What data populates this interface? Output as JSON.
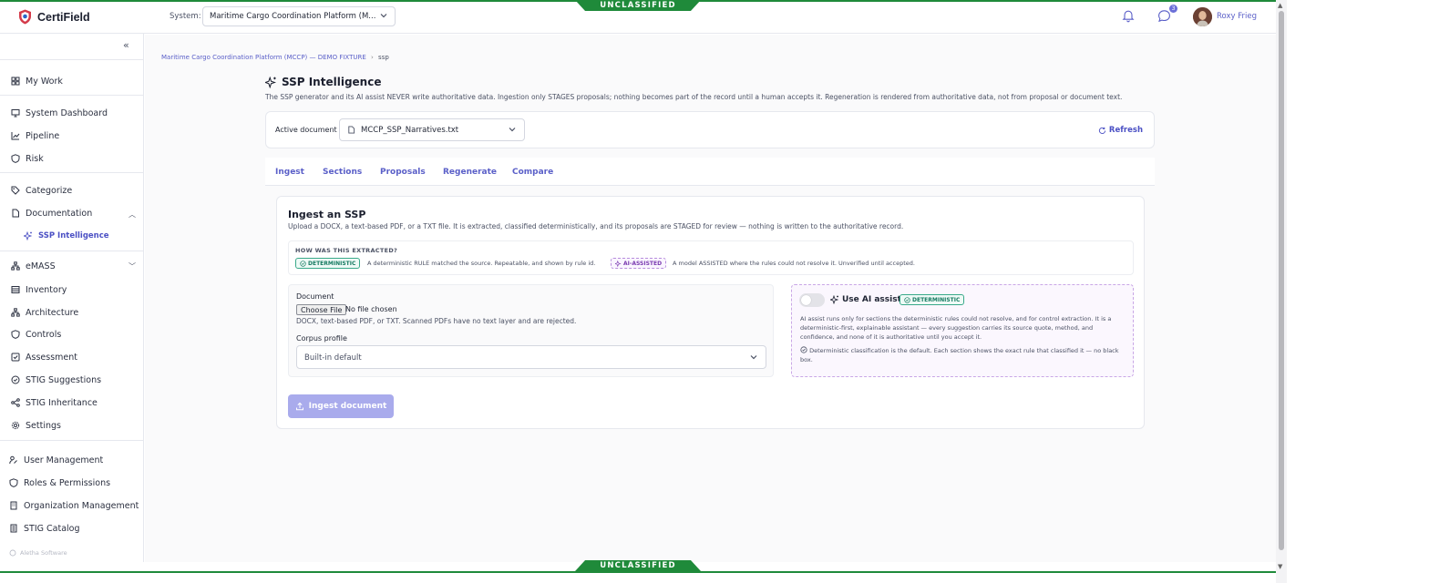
{
  "classification": {
    "banner": "UNCLASSIFIED"
  },
  "app": {
    "name": "CertiField"
  },
  "header": {
    "system_label": "System:",
    "system_value": "Maritime Cargo Coordination Platform (M...",
    "notification_count": "3",
    "user_name": "Roxy Frieg"
  },
  "sidebar": {
    "collapse_icon": "«",
    "items": [
      {
        "label": "My Work",
        "icon": "grid-icon"
      },
      {
        "label": "System Dashboard",
        "icon": "monitor-icon"
      },
      {
        "label": "Pipeline",
        "icon": "trend-icon"
      },
      {
        "label": "Risk",
        "icon": "shield-icon"
      },
      {
        "label": "Categorize",
        "icon": "tag-icon"
      },
      {
        "label": "Documentation",
        "icon": "file-icon"
      },
      {
        "label": "SSP Intelligence",
        "icon": "sparkle-icon"
      },
      {
        "label": "eMASS",
        "icon": "network-icon"
      },
      {
        "label": "Inventory",
        "icon": "list-icon"
      },
      {
        "label": "Architecture",
        "icon": "network-icon"
      },
      {
        "label": "Controls",
        "icon": "shield-icon"
      },
      {
        "label": "Assessment",
        "icon": "check-square-icon"
      },
      {
        "label": "STIG Suggestions",
        "icon": "check-circle-icon"
      },
      {
        "label": "STIG Inheritance",
        "icon": "share-icon"
      },
      {
        "label": "Settings",
        "icon": "gear-icon"
      },
      {
        "label": "User Management",
        "icon": "user-pen-icon"
      },
      {
        "label": "Roles & Permissions",
        "icon": "shield-icon"
      },
      {
        "label": "Organization Management",
        "icon": "building-icon"
      },
      {
        "label": "STIG Catalog",
        "icon": "book-icon"
      }
    ],
    "footer": "Aletha Software"
  },
  "breadcrumb": {
    "root": "Maritime Cargo Coordination Platform (MCCP) — DEMO FIXTURE",
    "sep": "›",
    "current": "ssp"
  },
  "page": {
    "title": "SSP Intelligence",
    "description": "The SSP generator and its AI assist NEVER write authoritative data. Ingestion only STAGES proposals; nothing becomes part of the record until a human accepts it. Regeneration is rendered from authoritative data, not from proposal or document text."
  },
  "document_bar": {
    "label": "Active document",
    "selected": "MCCP_SSP_Narratives.txt",
    "refresh": "Refresh"
  },
  "tabs": [
    "Ingest",
    "Sections",
    "Proposals",
    "Regenerate",
    "Compare"
  ],
  "ingest": {
    "title": "Ingest an SSP",
    "description": "Upload a DOCX, a text-based PDF, or a TXT file. It is extracted, classified deterministically, and its proposals are STAGED for review — nothing is written to the authoritative record.",
    "how_title": "HOW WAS THIS EXTRACTED?",
    "det_pill": "DETERMINISTIC",
    "det_text": "A deterministic RULE matched the source. Repeatable, and shown by rule id.",
    "ai_pill": "AI-ASSISTED",
    "ai_text": "A model ASSISTED where the rules could not resolve it. Unverified until accepted.",
    "document_label": "Document",
    "choose_file": "Choose File",
    "no_file": "No file chosen",
    "file_hint": "DOCX, text-based PDF, or TXT. Scanned PDFs have no text layer and are rejected.",
    "corpus_label": "Corpus profile",
    "corpus_value": "Built-in default",
    "ai_assist_label": "Use AI assist",
    "ai_assist_pill": "DETERMINISTIC",
    "ai_assist_enabled": false,
    "ai_desc": "AI assist runs only for sections the deterministic rules could not resolve, and for control extraction. It is a deterministic-first, explainable assistant — every suggestion carries its source quote, method, and confidence, and none of it is authoritative until you accept it.",
    "ai_note": "Deterministic classification is the default. Each section shows the exact rule that classified it — no black box.",
    "button": "Ingest document"
  }
}
